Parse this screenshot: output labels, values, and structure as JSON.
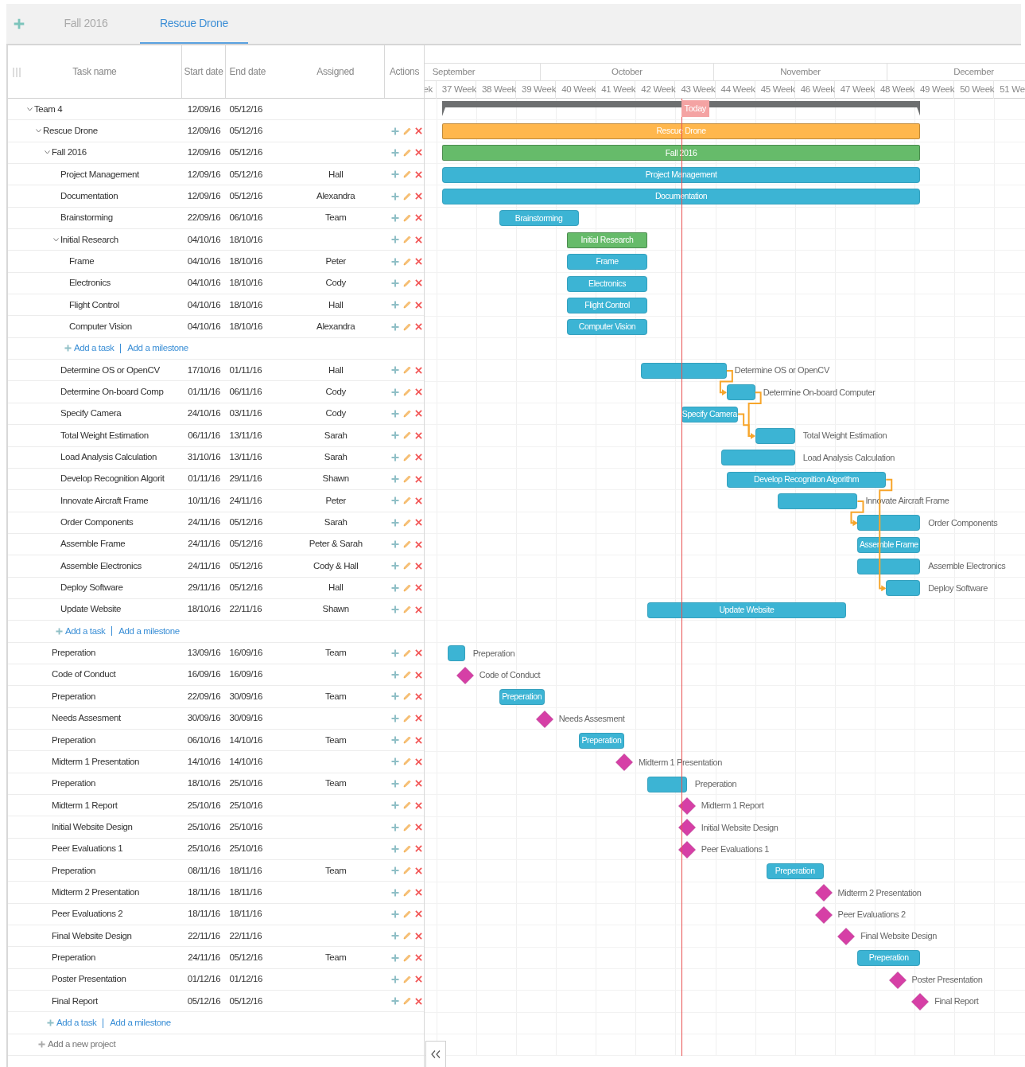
{
  "tabs": [
    {
      "label": "Fall 2016",
      "selected": false
    },
    {
      "label": "Rescue Drone",
      "selected": true
    }
  ],
  "columns": [
    "Task name",
    "Start date",
    "End date",
    "Assigned",
    "Actions"
  ],
  "timeline": {
    "months": [
      "September",
      "October",
      "November",
      "December"
    ],
    "weeks": [
      "ek",
      "37 Week",
      "38 Week",
      "39 Week",
      "40 Week",
      "41 Week",
      "42 Week",
      "43 Week",
      "44 Week",
      "45 Week",
      "46 Week",
      "47 Week",
      "48 Week",
      "49 Week",
      "50 Week",
      "51 We"
    ],
    "today": {
      "label": "Today"
    }
  },
  "tree": {
    "kind": "summary",
    "name": "Team 4",
    "start": "12/09/16",
    "end": "05/12/16",
    "expanded": true,
    "color": "#6d6f70",
    "add_project": "Add a new project",
    "children": [
      {
        "kind": "project",
        "name": "Rescue Drone",
        "start": "12/09/16",
        "end": "05/12/16",
        "expanded": true,
        "color": "#ffb74d",
        "bar_label": "Rescue Drone",
        "label_inside": true,
        "add_row": {
          "task": "Add a task",
          "milestone": "Add a milestone"
        },
        "children": [
          {
            "kind": "project",
            "name": "Fall 2016",
            "start": "12/09/16",
            "end": "05/12/16",
            "expanded": true,
            "color": "#66bb6a",
            "bar_label": "Fall 2016",
            "label_inside": true,
            "add_row": {
              "task": "Add a task",
              "milestone": "Add a milestone"
            },
            "children": [
              {
                "kind": "task",
                "name": "Project Management",
                "start": "12/09/16",
                "end": "05/12/16",
                "assigned": "Hall",
                "color": "#3cb4d4",
                "bar_label": "Project Management",
                "label_inside": true
              },
              {
                "kind": "task",
                "name": "Documentation",
                "start": "12/09/16",
                "end": "05/12/16",
                "assigned": "Alexandra",
                "color": "#3cb4d4",
                "bar_label": "Documentation",
                "label_inside": true
              },
              {
                "kind": "task",
                "name": "Brainstorming",
                "start": "22/09/16",
                "end": "06/10/16",
                "assigned": "Team",
                "color": "#3cb4d4",
                "bar_label": "Brainstorming",
                "label_inside": true
              },
              {
                "kind": "project",
                "name": "Initial Research",
                "start": "04/10/16",
                "end": "18/10/16",
                "expanded": true,
                "color": "#66bb6a",
                "bar_label": "Initial Research",
                "label_inside": true,
                "add_row": {
                  "task": "Add a task",
                  "milestone": "Add a milestone"
                },
                "children": [
                  {
                    "kind": "task",
                    "name": "Frame",
                    "start": "04/10/16",
                    "end": "18/10/16",
                    "assigned": "Peter",
                    "color": "#3cb4d4",
                    "bar_label": "Frame",
                    "label_inside": true
                  },
                  {
                    "kind": "task",
                    "name": "Electronics",
                    "start": "04/10/16",
                    "end": "18/10/16",
                    "assigned": "Cody",
                    "color": "#3cb4d4",
                    "bar_label": "Electronics",
                    "label_inside": true
                  },
                  {
                    "kind": "task",
                    "name": "Flight Control",
                    "start": "04/10/16",
                    "end": "18/10/16",
                    "assigned": "Hall",
                    "color": "#3cb4d4",
                    "bar_label": "Flight Control",
                    "label_inside": true
                  },
                  {
                    "kind": "task",
                    "name": "Computer Vision",
                    "start": "04/10/16",
                    "end": "18/10/16",
                    "assigned": "Alexandra",
                    "color": "#3cb4d4",
                    "bar_label": "Computer Vision",
                    "label_inside": true
                  }
                ]
              },
              {
                "kind": "task",
                "name": "Determine OS or OpenCV",
                "start": "17/10/16",
                "end": "01/11/16",
                "assigned": "Hall",
                "color": "#3cb4d4",
                "bar_label": "Determine OS or OpenCV",
                "label_inside": false
              },
              {
                "kind": "task",
                "name": "Determine On-board Comp",
                "start": "01/11/16",
                "end": "06/11/16",
                "assigned": "Cody",
                "color": "#3cb4d4",
                "bar_label": "Determine On-board Computer",
                "label_inside": false
              },
              {
                "kind": "task",
                "name": "Specify Camera",
                "start": "24/10/16",
                "end": "03/11/16",
                "assigned": "Cody",
                "color": "#3cb4d4",
                "bar_label": "Specify Camera",
                "label_inside": true
              },
              {
                "kind": "task",
                "name": "Total Weight Estimation",
                "start": "06/11/16",
                "end": "13/11/16",
                "assigned": "Sarah",
                "color": "#3cb4d4",
                "bar_label": "Total Weight Estimation",
                "label_inside": false
              },
              {
                "kind": "task",
                "name": "Load Analysis Calculation",
                "start": "31/10/16",
                "end": "13/11/16",
                "assigned": "Sarah",
                "color": "#3cb4d4",
                "bar_label": "Load Analysis Calculation",
                "label_inside": false
              },
              {
                "kind": "task",
                "name": "Develop Recognition Algorit",
                "start": "01/11/16",
                "end": "29/11/16",
                "assigned": "Shawn",
                "color": "#3cb4d4",
                "bar_label": "Develop Recognition Algorithm",
                "label_inside": true
              },
              {
                "kind": "task",
                "name": "Innovate Aircraft Frame",
                "start": "10/11/16",
                "end": "24/11/16",
                "assigned": "Peter",
                "color": "#3cb4d4",
                "bar_label": "Innovate Aircraft Frame",
                "label_inside": false
              },
              {
                "kind": "task",
                "name": "Order Components",
                "start": "24/11/16",
                "end": "05/12/16",
                "assigned": "Sarah",
                "color": "#3cb4d4",
                "bar_label": "Order Components",
                "label_inside": false
              },
              {
                "kind": "task",
                "name": "Assemble Frame",
                "start": "24/11/16",
                "end": "05/12/16",
                "assigned": "Peter & Sarah",
                "color": "#3cb4d4",
                "bar_label": "Assemble Frame",
                "label_inside": true
              },
              {
                "kind": "task",
                "name": "Assemble Electronics",
                "start": "24/11/16",
                "end": "05/12/16",
                "assigned": "Cody & Hall",
                "color": "#3cb4d4",
                "bar_label": "Assemble Electronics",
                "label_inside": false
              },
              {
                "kind": "task",
                "name": "Deploy Software",
                "start": "29/11/16",
                "end": "05/12/16",
                "assigned": "Hall",
                "color": "#3cb4d4",
                "bar_label": "Deploy Software",
                "label_inside": false
              },
              {
                "kind": "task",
                "name": "Update Website",
                "start": "18/10/16",
                "end": "22/11/16",
                "assigned": "Shawn",
                "color": "#3cb4d4",
                "bar_label": "Update Website",
                "label_inside": true
              }
            ]
          },
          {
            "kind": "task",
            "name": "Preperation",
            "start": "13/09/16",
            "end": "16/09/16",
            "assigned": "Team",
            "color": "#3cb4d4",
            "bar_label": "Preperation",
            "label_inside": false
          },
          {
            "kind": "milestone",
            "name": "Code of Conduct",
            "start": "16/09/16",
            "end": "16/09/16",
            "color": "#d63fa6",
            "bar_label": "Code of Conduct"
          },
          {
            "kind": "task",
            "name": "Preperation",
            "start": "22/09/16",
            "end": "30/09/16",
            "assigned": "Team",
            "color": "#3cb4d4",
            "bar_label": "Preperation",
            "label_inside": true
          },
          {
            "kind": "milestone",
            "name": "Needs Assesment",
            "start": "30/09/16",
            "end": "30/09/16",
            "color": "#d63fa6",
            "bar_label": "Needs Assesment"
          },
          {
            "kind": "task",
            "name": "Preperation",
            "start": "06/10/16",
            "end": "14/10/16",
            "assigned": "Team",
            "color": "#3cb4d4",
            "bar_label": "Preperation",
            "label_inside": true
          },
          {
            "kind": "milestone",
            "name": "Midterm 1 Presentation",
            "start": "14/10/16",
            "end": "14/10/16",
            "color": "#d63fa6",
            "bar_label": "Midterm 1 Presentation"
          },
          {
            "kind": "task",
            "name": "Preperation",
            "start": "18/10/16",
            "end": "25/10/16",
            "assigned": "Team",
            "color": "#3cb4d4",
            "bar_label": "Preperation",
            "label_inside": false
          },
          {
            "kind": "milestone",
            "name": "Midterm 1 Report",
            "start": "25/10/16",
            "end": "25/10/16",
            "color": "#d63fa6",
            "bar_label": "Midterm 1 Report"
          },
          {
            "kind": "milestone",
            "name": "Initial Website Design",
            "start": "25/10/16",
            "end": "25/10/16",
            "color": "#d63fa6",
            "bar_label": "Initial Website Design"
          },
          {
            "kind": "milestone",
            "name": "Peer Evaluations 1",
            "start": "25/10/16",
            "end": "25/10/16",
            "color": "#d63fa6",
            "bar_label": "Peer Evaluations 1"
          },
          {
            "kind": "task",
            "name": "Preperation",
            "start": "08/11/16",
            "end": "18/11/16",
            "assigned": "Team",
            "color": "#3cb4d4",
            "bar_label": "Preperation",
            "label_inside": true
          },
          {
            "kind": "milestone",
            "name": "Midterm 2 Presentation",
            "start": "18/11/16",
            "end": "18/11/16",
            "color": "#d63fa6",
            "bar_label": "Midterm 2 Presentation"
          },
          {
            "kind": "milestone",
            "name": "Peer Evaluations 2",
            "start": "18/11/16",
            "end": "18/11/16",
            "color": "#d63fa6",
            "bar_label": "Peer Evaluations 2"
          },
          {
            "kind": "milestone",
            "name": "Final Website Design",
            "start": "22/11/16",
            "end": "22/11/16",
            "color": "#d63fa6",
            "bar_label": "Final Website Design"
          },
          {
            "kind": "task",
            "name": "Preperation",
            "start": "24/11/16",
            "end": "05/12/16",
            "assigned": "Team",
            "color": "#3cb4d4",
            "bar_label": "Preperation",
            "label_inside": true
          },
          {
            "kind": "milestone",
            "name": "Poster Presentation",
            "start": "01/12/16",
            "end": "01/12/16",
            "color": "#d63fa6",
            "bar_label": "Poster Presentation"
          },
          {
            "kind": "milestone",
            "name": "Final Report",
            "start": "05/12/16",
            "end": "05/12/16",
            "color": "#d63fa6",
            "bar_label": "Final Report"
          }
        ]
      }
    ]
  }
}
